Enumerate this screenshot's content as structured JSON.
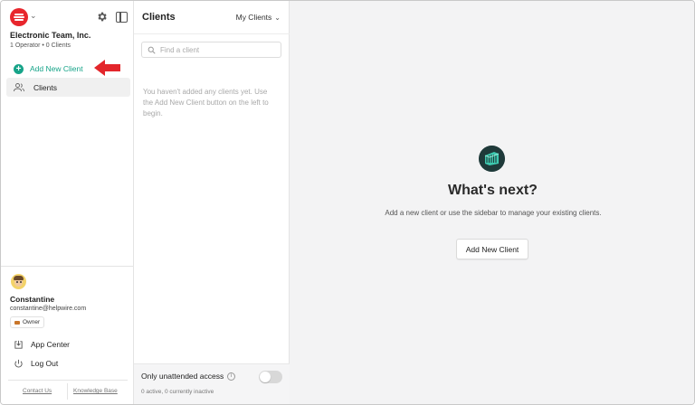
{
  "sidebar": {
    "team_name": "Electronic Team, Inc.",
    "team_meta": "1 Operator • 0 Clients",
    "add_client_label": "Add New Client",
    "clients_label": "Clients",
    "user": {
      "name": "Constantine",
      "email": "constantine@helpwire.com",
      "role": "Owner"
    },
    "app_center_label": "App Center",
    "logout_label": "Log Out",
    "footer": {
      "contact": "Contact Us",
      "knowledge_base": "Knowledge Base"
    }
  },
  "clients_panel": {
    "title": "Clients",
    "filter": "My Clients",
    "search_placeholder": "Find a client",
    "empty_message": "You haven't added any clients yet. Use the Add New Client button on the left to begin.",
    "unattended_label": "Only unattended access",
    "active_info": "0 active, 0 currently inactive"
  },
  "main": {
    "title": "What's next?",
    "description": "Add a new client or use the sidebar to manage your existing clients.",
    "button_label": "Add New Client"
  },
  "colors": {
    "brand_red": "#e8262d",
    "accent_green": "#17a489",
    "main_icon_bg": "#1f3a3a"
  },
  "icons": {
    "logo": "helpwire-logo-icon",
    "settings": "gear-icon",
    "panel": "sidebar-toggle-icon",
    "add": "plus-circle-icon",
    "clients": "users-icon",
    "app_center": "download-box-icon",
    "logout": "power-icon",
    "search": "search-icon",
    "info": "info-icon",
    "arrow": "red-arrow-icon"
  }
}
